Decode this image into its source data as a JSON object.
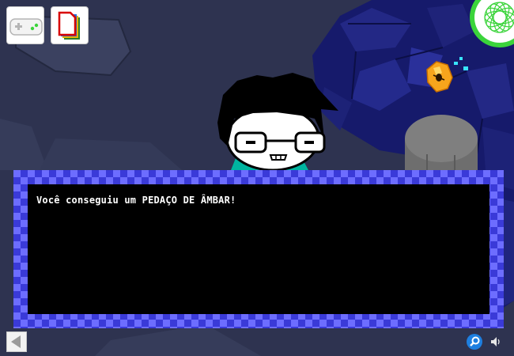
{
  "dialog": {
    "message": "Você conseguiu um PEDAÇO DE ÂMBAR!"
  },
  "toolbar": {
    "icons": [
      "gamepad-icon",
      "journal-icon",
      "spirograph-icon"
    ]
  },
  "controls": {
    "icons": [
      "back-arrow-icon",
      "zoom-icon",
      "speaker-icon"
    ]
  },
  "colors": {
    "background": "#2e3350",
    "dialog_border_light": "#6d6dff",
    "dialog_border_dark": "#3a3ad8",
    "dialog_fill": "#000000",
    "dialog_text": "#ffffff",
    "spirograph_green": "#3bd43b",
    "amber": "#f7a51c",
    "teal_shirt": "#00b4a0"
  }
}
